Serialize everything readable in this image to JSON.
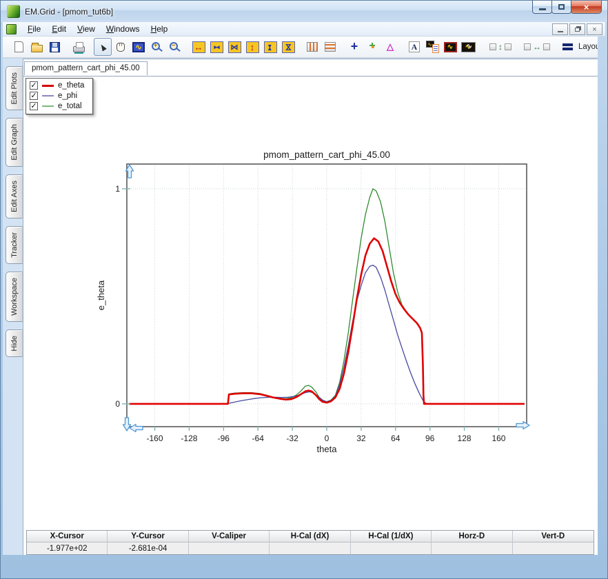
{
  "window": {
    "title": "EM.Grid - [pmom_tut6b]",
    "controls": [
      "minimize",
      "maximize",
      "close"
    ],
    "mdi_controls": [
      "minimize",
      "restore",
      "close"
    ]
  },
  "menu": {
    "items": [
      {
        "label": "File",
        "key": "F",
        "rest": "ile"
      },
      {
        "label": "Edit",
        "key": "E",
        "rest": "dit"
      },
      {
        "label": "View",
        "key": "V",
        "rest": "iew"
      },
      {
        "label": "Windows",
        "key": "W",
        "rest": "indows"
      },
      {
        "label": "Help",
        "key": "H",
        "rest": "elp"
      }
    ]
  },
  "toolbar": {
    "layout_label": "Layou",
    "active_icon": "select-pointer",
    "icons": [
      "new-file",
      "open-file",
      "save",
      "print",
      "select-pointer",
      "pan-hand",
      "zoom-region",
      "zoom-in",
      "zoom-out",
      "expand-x",
      "shrink-x",
      "autoscale-x",
      "expand-y",
      "shrink-y",
      "autoscale-y",
      "vertical-markers",
      "horizontal-markers",
      "crosshair",
      "tracker",
      "caliper",
      "text-annotation",
      "plot-report",
      "plot-single",
      "plot-overlay",
      "fit-vertical",
      "fit-horizontal",
      "layout"
    ]
  },
  "sidebar": {
    "tabs": [
      "Edit Plots",
      "Edit Graph",
      "Edit Axes",
      "Tracker",
      "Workspace",
      "Hide"
    ]
  },
  "doc": {
    "tab_label": "pmom_pattern_cart_phi_45.00"
  },
  "legend": {
    "items": [
      {
        "label": "e_theta",
        "color": "#d40000",
        "checked": true
      },
      {
        "label": "e_phi",
        "color": "#8888c4",
        "checked": true
      },
      {
        "label": "e_total",
        "color": "#7cb87c",
        "checked": true
      }
    ]
  },
  "status_bar": {
    "columns": [
      {
        "label": "X-Cursor",
        "value": "-1.977e+02"
      },
      {
        "label": "Y-Cursor",
        "value": "-2.681e-04"
      },
      {
        "label": "V-Caliper",
        "value": ""
      },
      {
        "label": "H-Cal (dX)",
        "value": ""
      },
      {
        "label": "H-Cal (1/dX)",
        "value": ""
      },
      {
        "label": "Horz-D",
        "value": ""
      },
      {
        "label": "Vert-D",
        "value": ""
      }
    ]
  },
  "chart_data": {
    "type": "line",
    "title": "pmom_pattern_cart_phi_45.00",
    "xlabel": "theta",
    "ylabel": "e_theta",
    "xlim": [
      -186,
      186
    ],
    "ylim": [
      -0.106,
      1.115
    ],
    "xticks": [
      -160,
      -128,
      -96,
      -64,
      -32,
      0,
      32,
      64,
      96,
      128,
      160
    ],
    "yticks": [
      0,
      1
    ],
    "grid": true,
    "legend_position": "top-left-floating",
    "series": [
      {
        "name": "e_theta",
        "color": "#e00000",
        "width": 2.6,
        "points": [
          [
            -184,
            0
          ],
          [
            -92,
            0
          ],
          [
            -91,
            0.044
          ],
          [
            -86,
            0.047
          ],
          [
            -78,
            0.049
          ],
          [
            -70,
            0.049
          ],
          [
            -62,
            0.045
          ],
          [
            -56,
            0.038
          ],
          [
            -50,
            0.03
          ],
          [
            -44,
            0.024
          ],
          [
            -38,
            0.02
          ],
          [
            -33,
            0.022
          ],
          [
            -28,
            0.032
          ],
          [
            -24,
            0.045
          ],
          [
            -20,
            0.058
          ],
          [
            -17,
            0.062
          ],
          [
            -14,
            0.058
          ],
          [
            -10,
            0.04
          ],
          [
            -7,
            0.022
          ],
          [
            -4,
            0.01
          ],
          [
            0,
            0.006
          ],
          [
            4,
            0.012
          ],
          [
            8,
            0.03
          ],
          [
            12,
            0.07
          ],
          [
            16,
            0.14
          ],
          [
            20,
            0.24
          ],
          [
            24,
            0.36
          ],
          [
            28,
            0.49
          ],
          [
            32,
            0.6
          ],
          [
            36,
            0.69
          ],
          [
            40,
            0.745
          ],
          [
            44,
            0.77
          ],
          [
            48,
            0.755
          ],
          [
            52,
            0.71
          ],
          [
            56,
            0.64
          ],
          [
            60,
            0.57
          ],
          [
            64,
            0.51
          ],
          [
            68,
            0.47
          ],
          [
            72,
            0.44
          ],
          [
            76,
            0.415
          ],
          [
            80,
            0.395
          ],
          [
            84,
            0.375
          ],
          [
            87,
            0.352
          ],
          [
            88.5,
            0.33
          ],
          [
            89.5,
            0.18
          ],
          [
            90,
            0.04
          ],
          [
            90.5,
            0
          ],
          [
            184,
            0
          ]
        ]
      },
      {
        "name": "e_phi",
        "color": "#4848a0",
        "width": 1.3,
        "points": [
          [
            -184,
            0
          ],
          [
            -95,
            0
          ],
          [
            -90,
            0.004
          ],
          [
            -84,
            0.01
          ],
          [
            -78,
            0.016
          ],
          [
            -72,
            0.021
          ],
          [
            -66,
            0.026
          ],
          [
            -60,
            0.029
          ],
          [
            -54,
            0.031
          ],
          [
            -48,
            0.031
          ],
          [
            -42,
            0.03
          ],
          [
            -36,
            0.031
          ],
          [
            -30,
            0.035
          ],
          [
            -25,
            0.042
          ],
          [
            -20,
            0.052
          ],
          [
            -16,
            0.056
          ],
          [
            -12,
            0.05
          ],
          [
            -8,
            0.035
          ],
          [
            -4,
            0.018
          ],
          [
            0,
            0.01
          ],
          [
            4,
            0.016
          ],
          [
            8,
            0.035
          ],
          [
            12,
            0.09
          ],
          [
            16,
            0.17
          ],
          [
            20,
            0.27
          ],
          [
            24,
            0.38
          ],
          [
            28,
            0.48
          ],
          [
            32,
            0.55
          ],
          [
            36,
            0.61
          ],
          [
            40,
            0.64
          ],
          [
            43,
            0.645
          ],
          [
            46,
            0.635
          ],
          [
            50,
            0.59
          ],
          [
            54,
            0.53
          ],
          [
            58,
            0.46
          ],
          [
            62,
            0.39
          ],
          [
            66,
            0.32
          ],
          [
            70,
            0.26
          ],
          [
            74,
            0.2
          ],
          [
            78,
            0.145
          ],
          [
            82,
            0.095
          ],
          [
            86,
            0.05
          ],
          [
            90,
            0.012
          ],
          [
            93,
            0
          ],
          [
            184,
            0
          ]
        ]
      },
      {
        "name": "e_total",
        "color": "#2e8b2e",
        "width": 1.3,
        "points": [
          [
            -184,
            0
          ],
          [
            -92,
            0
          ],
          [
            -91,
            0.046
          ],
          [
            -86,
            0.05
          ],
          [
            -78,
            0.052
          ],
          [
            -70,
            0.052
          ],
          [
            -62,
            0.048
          ],
          [
            -56,
            0.04
          ],
          [
            -50,
            0.032
          ],
          [
            -44,
            0.026
          ],
          [
            -38,
            0.024
          ],
          [
            -33,
            0.028
          ],
          [
            -28,
            0.042
          ],
          [
            -24,
            0.06
          ],
          [
            -20,
            0.082
          ],
          [
            -17,
            0.086
          ],
          [
            -14,
            0.078
          ],
          [
            -10,
            0.055
          ],
          [
            -7,
            0.03
          ],
          [
            -4,
            0.014
          ],
          [
            0,
            0.01
          ],
          [
            4,
            0.018
          ],
          [
            8,
            0.04
          ],
          [
            12,
            0.1
          ],
          [
            16,
            0.2
          ],
          [
            20,
            0.33
          ],
          [
            24,
            0.48
          ],
          [
            28,
            0.63
          ],
          [
            32,
            0.77
          ],
          [
            36,
            0.88
          ],
          [
            40,
            0.96
          ],
          [
            43,
            1
          ],
          [
            46,
            0.99
          ],
          [
            50,
            0.94
          ],
          [
            54,
            0.85
          ],
          [
            58,
            0.73
          ],
          [
            62,
            0.61
          ],
          [
            66,
            0.52
          ],
          [
            70,
            0.46
          ],
          [
            74,
            0.43
          ],
          [
            78,
            0.405
          ],
          [
            82,
            0.385
          ],
          [
            85,
            0.365
          ],
          [
            87,
            0.352
          ],
          [
            88.5,
            0.33
          ],
          [
            89.5,
            0.18
          ],
          [
            90,
            0.04
          ],
          [
            90.5,
            0
          ],
          [
            184,
            0
          ]
        ]
      }
    ]
  }
}
